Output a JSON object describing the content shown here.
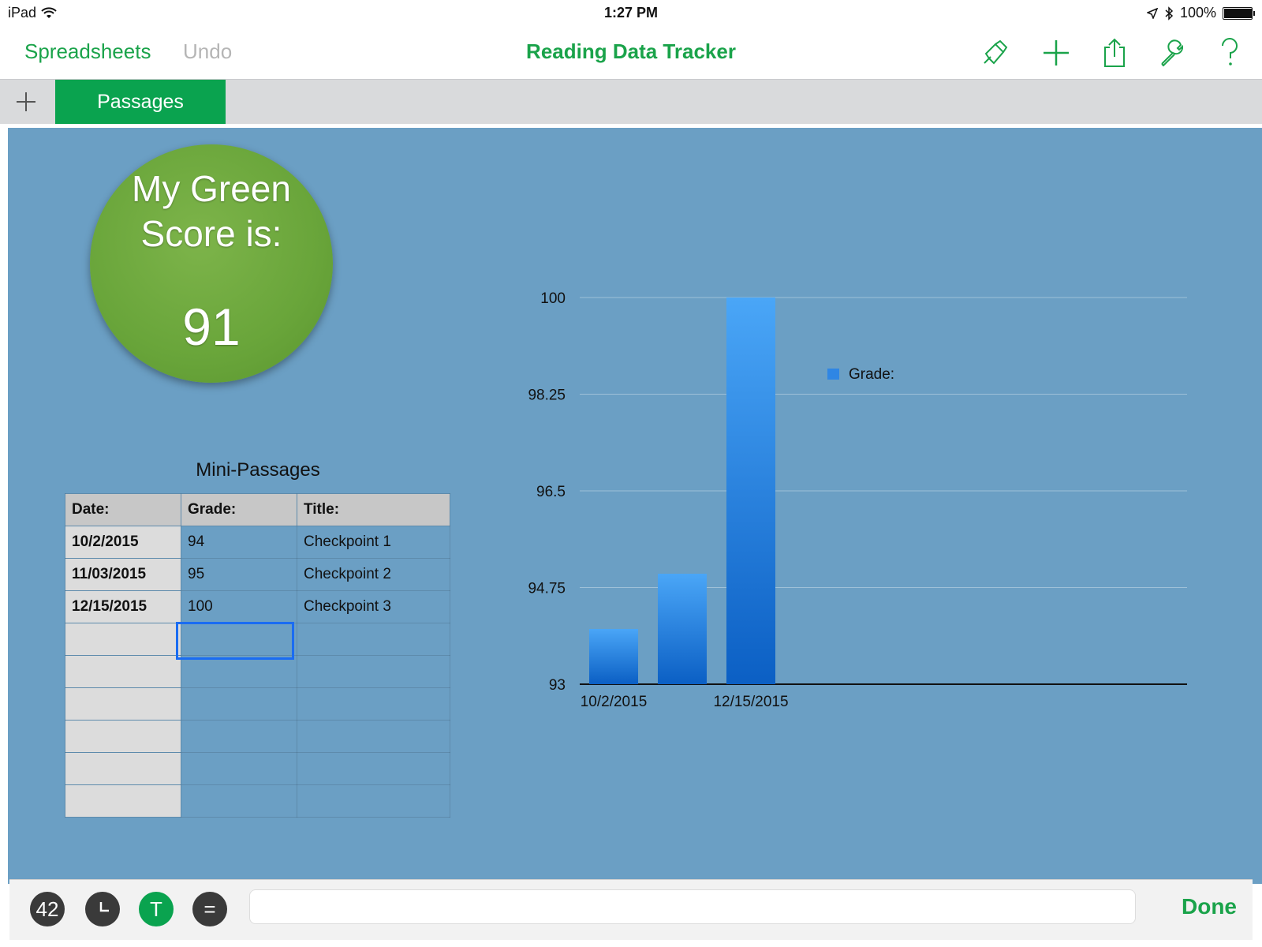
{
  "status_bar": {
    "device": "iPad",
    "time": "1:27 PM",
    "battery": "100%",
    "battery_level": 1.0
  },
  "nav": {
    "left_link": "Spreadsheets",
    "undo": "Undo",
    "title": "Reading Data Tracker",
    "icons": [
      "format-brush-icon",
      "plus-icon",
      "share-icon",
      "wrench-icon",
      "help-icon"
    ]
  },
  "tabs": [
    {
      "label": "Passages",
      "active": true
    }
  ],
  "score": {
    "label": "My Green Score is:",
    "value": "91"
  },
  "table": {
    "title": "Mini-Passages",
    "headers": [
      "Date:",
      "Grade:",
      "Title:"
    ],
    "rows": [
      [
        "10/2/2015",
        "94",
        "Checkpoint 1"
      ],
      [
        "11/03/2015",
        "95",
        "Checkpoint 2"
      ],
      [
        "12/15/2015",
        "100",
        "Checkpoint 3"
      ],
      [
        "",
        "",
        ""
      ],
      [
        "",
        "",
        ""
      ],
      [
        "",
        "",
        ""
      ],
      [
        "",
        "",
        ""
      ],
      [
        "",
        "",
        ""
      ],
      [
        "",
        "",
        ""
      ]
    ]
  },
  "chart_data": {
    "type": "bar",
    "categories": [
      "10/2/2015",
      "11/03/2015",
      "12/15/2015"
    ],
    "category_labels_shown": [
      "10/2/2015",
      "",
      "12/15/2015"
    ],
    "series": [
      {
        "name": "Grade:",
        "values": [
          94,
          95,
          100
        ]
      }
    ],
    "yticks": [
      "100",
      "98.25",
      "96.5",
      "94.75",
      "93"
    ],
    "ylim": [
      93,
      100
    ],
    "grid": true,
    "legend": "top-center",
    "bar_color": "#2f86e4"
  },
  "formula_bar": {
    "buttons": [
      "42",
      "clock",
      "T",
      "="
    ],
    "input_value": "",
    "done": "Done"
  },
  "colors": {
    "accent": "#1aa34a",
    "tab_green": "#0aa34f",
    "canvas_bg": "#6b9fc4",
    "muted": "#b5b5b5"
  }
}
